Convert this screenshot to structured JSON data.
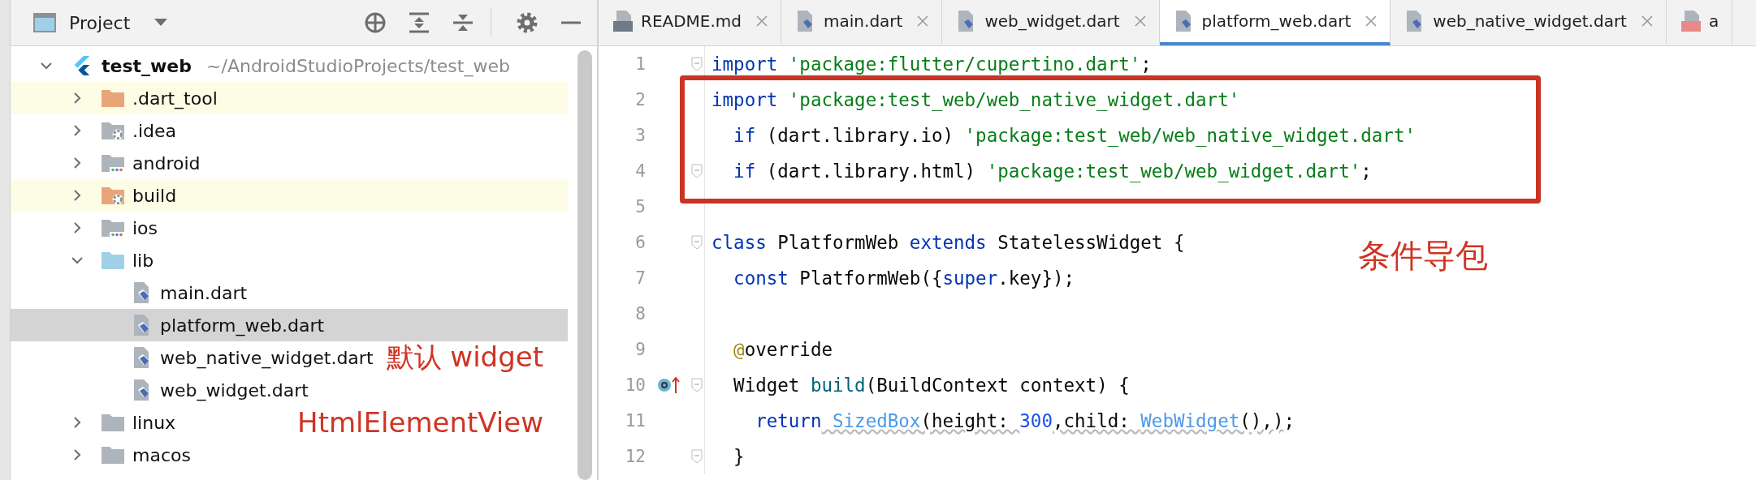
{
  "project_panel": {
    "title": "Project",
    "tree": [
      {
        "label": "test_web",
        "path": "~/AndroidStudioProjects/test_web",
        "kind": "flutter",
        "expanded": true,
        "highlighted": false,
        "selected": false,
        "children": [
          {
            "label": ".dart_tool",
            "kind": "excluded",
            "expanded": false,
            "highlighted": true,
            "selected": false
          },
          {
            "label": ".idea",
            "kind": "config",
            "expanded": false,
            "highlighted": false,
            "selected": false
          },
          {
            "label": "android",
            "kind": "module",
            "expanded": false,
            "highlighted": false,
            "selected": false
          },
          {
            "label": "build",
            "kind": "excluded-config",
            "expanded": false,
            "highlighted": true,
            "selected": false
          },
          {
            "label": "ios",
            "kind": "module",
            "expanded": false,
            "highlighted": false,
            "selected": false
          },
          {
            "label": "lib",
            "kind": "source",
            "expanded": true,
            "highlighted": false,
            "selected": false,
            "children": [
              {
                "label": "main.dart",
                "kind": "dart",
                "highlighted": false,
                "selected": false
              },
              {
                "label": "platform_web.dart",
                "kind": "dart",
                "highlighted": false,
                "selected": true
              },
              {
                "label": "web_native_widget.dart",
                "kind": "dart",
                "highlighted": false,
                "selected": false,
                "note": "默认 widget"
              },
              {
                "label": "web_widget.dart",
                "kind": "dart",
                "highlighted": false,
                "selected": false
              }
            ]
          },
          {
            "label": "linux",
            "kind": "folder",
            "expanded": false,
            "highlighted": false,
            "selected": false,
            "note": "HtmlElementView"
          },
          {
            "label": "macos",
            "kind": "folder",
            "expanded": false,
            "highlighted": false,
            "selected": false
          }
        ]
      }
    ]
  },
  "editor": {
    "tabs": [
      {
        "label": "README.md",
        "kind": "md",
        "selected": false
      },
      {
        "label": "main.dart",
        "kind": "dart",
        "selected": false
      },
      {
        "label": "web_widget.dart",
        "kind": "dart",
        "selected": false
      },
      {
        "label": "platform_web.dart",
        "kind": "dart",
        "selected": true
      },
      {
        "label": "web_native_widget.dart",
        "kind": "dart",
        "selected": false
      },
      {
        "label": "a",
        "kind": "yml",
        "selected": false
      }
    ],
    "lines": [
      {
        "number": "1",
        "fold": true,
        "marker": false,
        "tokens": [
          {
            "kind": "kw",
            "text": "import"
          },
          {
            "kind": "str",
            "text": " 'package:flutter/cupertino.dart'"
          },
          {
            "kind": "plain",
            "text": ";"
          }
        ]
      },
      {
        "number": "2",
        "fold": false,
        "marker": false,
        "tokens": [
          {
            "kind": "kw",
            "text": "import"
          },
          {
            "kind": "str",
            "text": " 'package:test_web/web_native_widget.dart'"
          }
        ]
      },
      {
        "number": "3",
        "fold": false,
        "marker": false,
        "tokens": [
          {
            "kind": "kw",
            "text": "  if"
          },
          {
            "kind": "plain",
            "text": " (dart.library.io) "
          },
          {
            "kind": "str",
            "text": "'package:test_web/web_native_widget.dart'"
          }
        ]
      },
      {
        "number": "4",
        "fold": true,
        "marker": false,
        "tokens": [
          {
            "kind": "kw",
            "text": "  if"
          },
          {
            "kind": "plain",
            "text": " (dart.library.html) "
          },
          {
            "kind": "str",
            "text": "'package:test_web/web_widget.dart'"
          },
          {
            "kind": "plain",
            "text": ";"
          }
        ]
      },
      {
        "number": "5",
        "fold": false,
        "marker": false
      },
      {
        "number": "6",
        "fold": true,
        "marker": false,
        "note": "条件导包",
        "tokens": [
          {
            "kind": "kw",
            "text": "class"
          },
          {
            "kind": "plain",
            "text": " PlatformWeb "
          },
          {
            "kind": "kw",
            "text": "extends"
          },
          {
            "kind": "plain",
            "text": " StatelessWidget {"
          }
        ]
      },
      {
        "number": "7",
        "fold": false,
        "marker": false,
        "tokens": [
          {
            "kind": "kw",
            "text": "  const"
          },
          {
            "kind": "plain",
            "text": " PlatformWeb({"
          },
          {
            "kind": "kw",
            "text": "super"
          },
          {
            "kind": "plain",
            "text": ".key});"
          }
        ]
      },
      {
        "number": "8",
        "fold": false,
        "marker": false
      },
      {
        "number": "9",
        "fold": false,
        "marker": false,
        "tokens": [
          {
            "kind": "annotation",
            "text": "  @"
          },
          {
            "kind": "plain",
            "text": "override"
          }
        ]
      },
      {
        "number": "10",
        "fold": true,
        "marker": true,
        "tokens": [
          {
            "kind": "plain",
            "text": "  Widget "
          },
          {
            "kind": "fn",
            "text": "build"
          },
          {
            "kind": "plain",
            "text": "(BuildContext context) {"
          }
        ]
      },
      {
        "number": "11",
        "fold": false,
        "marker": false,
        "tokens": [
          {
            "kind": "kw",
            "text": "    return"
          },
          {
            "kind": "ref",
            "text": " SizedBox"
          },
          {
            "kind": "plain-squiggle",
            "text": "(height: "
          },
          {
            "kind": "num",
            "text": "300"
          },
          {
            "kind": "plain-squiggle",
            "text": ",child: "
          },
          {
            "kind": "ref",
            "text": "WebWidget"
          },
          {
            "kind": "plain-squiggle",
            "text": "(),)"
          },
          {
            "kind": "plain",
            "text": ";"
          }
        ]
      },
      {
        "number": "12",
        "fold": true,
        "marker": false,
        "tokens": [
          {
            "kind": "plain",
            "text": "  }"
          }
        ]
      }
    ]
  }
}
